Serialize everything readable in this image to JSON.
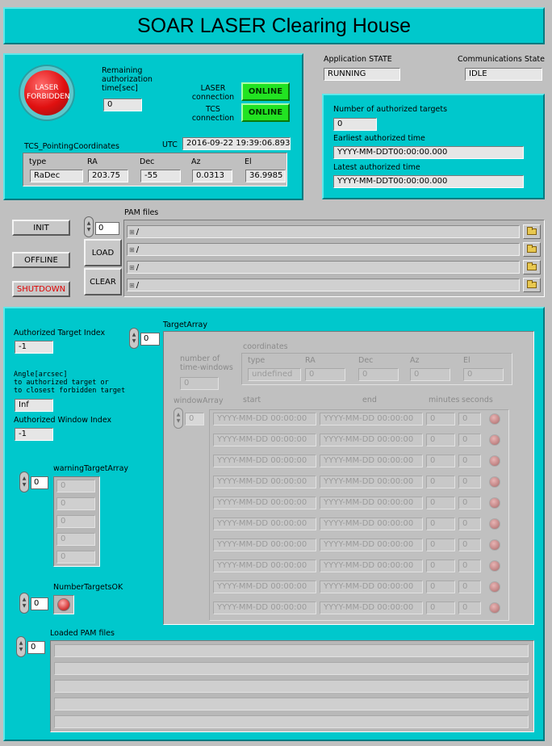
{
  "title": "SOAR LASER Clearing House",
  "status_panel": {
    "laser_button_label": "LASER FORBIDDEN",
    "remaining_label": "Remaining authorization time[sec]",
    "remaining_value": "0",
    "laser_conn_label": "LASER connection",
    "laser_conn_value": "ONLINE",
    "tcs_conn_label": "TCS connection",
    "tcs_conn_value": "ONLINE",
    "utc_label": "UTC",
    "utc_value": "2016-09-22 19:39:06.893",
    "tcs_label": "TCS_PointingCoordinates",
    "coord_headers": [
      "type",
      "RA",
      "Dec",
      "Az",
      "El"
    ],
    "coord_values": [
      "RaDec",
      "203.75",
      "-55",
      "0.0313",
      "36.9985"
    ]
  },
  "app_state_label": "Application STATE",
  "app_state_value": "RUNNING",
  "comm_state_label": "Communications State",
  "comm_state_value": "IDLE",
  "auth_panel": {
    "num_targets_label": "Number of authorized targets",
    "num_targets_value": "0",
    "earliest_label": "Earliest authorized time",
    "earliest_value": "YYYY-MM-DDT00:00:00.000",
    "latest_label": "Latest authorized time",
    "latest_value": "YYYY-MM-DDT00:00:00.000"
  },
  "controls": {
    "init": "INIT",
    "offline": "OFFLINE",
    "shutdown": "SHUTDOWN",
    "load": "LOAD",
    "clear": "CLEAR",
    "pam_label": "PAM files",
    "pam_index": "0",
    "pam_paths": [
      "/",
      "/",
      "/",
      "/"
    ]
  },
  "lower": {
    "auth_index_label": "Authorized Target Index",
    "auth_index_value": "-1",
    "angle_label": "Angle[arcsec]\nto authorized target or\nto closest forbidden target",
    "angle_value": "Inf",
    "auth_window_label": "Authorized Window Index",
    "auth_window_value": "-1",
    "warning_label": "warningTargetArray",
    "warning_index": "0",
    "warning_values": [
      "0",
      "0",
      "0",
      "0",
      "0"
    ],
    "number_ok_label": "NumberTargetsOK",
    "number_ok_index": "0",
    "loaded_label": "Loaded PAM files",
    "loaded_index": "0",
    "target_array_label": "TargetArray",
    "target_index": "0",
    "coordinates_label": "coordinates",
    "tw_label": "number of time-windows",
    "tw_value": "0",
    "coord_headers": [
      "type",
      "RA",
      "Dec",
      "Az",
      "El"
    ],
    "coord_values": [
      "undefined",
      "0",
      "0",
      "0",
      "0"
    ],
    "window_array_label": "windowArray",
    "window_index": "0",
    "window_headers": [
      "start",
      "end",
      "minutes",
      "seconds"
    ],
    "window_rows": [
      [
        "YYYY-MM-DD 00:00:00",
        "YYYY-MM-DD 00:00:00",
        "0",
        "0"
      ],
      [
        "YYYY-MM-DD 00:00:00",
        "YYYY-MM-DD 00:00:00",
        "0",
        "0"
      ],
      [
        "YYYY-MM-DD 00:00:00",
        "YYYY-MM-DD 00:00:00",
        "0",
        "0"
      ],
      [
        "YYYY-MM-DD 00:00:00",
        "YYYY-MM-DD 00:00:00",
        "0",
        "0"
      ],
      [
        "YYYY-MM-DD 00:00:00",
        "YYYY-MM-DD 00:00:00",
        "0",
        "0"
      ],
      [
        "YYYY-MM-DD 00:00:00",
        "YYYY-MM-DD 00:00:00",
        "0",
        "0"
      ],
      [
        "YYYY-MM-DD 00:00:00",
        "YYYY-MM-DD 00:00:00",
        "0",
        "0"
      ],
      [
        "YYYY-MM-DD 00:00:00",
        "YYYY-MM-DD 00:00:00",
        "0",
        "0"
      ],
      [
        "YYYY-MM-DD 00:00:00",
        "YYYY-MM-DD 00:00:00",
        "0",
        "0"
      ],
      [
        "YYYY-MM-DD 00:00:00",
        "YYYY-MM-DD 00:00:00",
        "0",
        "0"
      ]
    ]
  },
  "colors": {
    "teal": "#00c8cc",
    "online": "#22e322",
    "laser_red": "#d82020",
    "shutdown_text": "#e00000"
  }
}
